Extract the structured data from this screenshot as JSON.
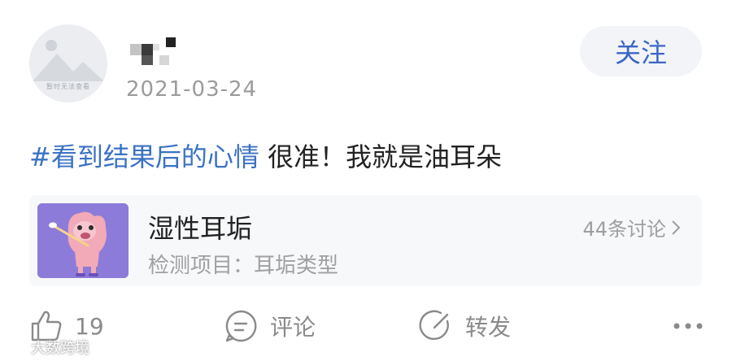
{
  "post": {
    "avatar_caption": "暂时无法查看",
    "date": "2021-03-24",
    "follow_label": "关注",
    "hashtag": "#看到结果后的心情",
    "body": " 很准！我就是油耳朵"
  },
  "card": {
    "title": "湿性耳垢",
    "subtitle": "检测项目：耳垢类型",
    "link": "44条讨论"
  },
  "actions": {
    "like_count": "19",
    "comment_label": "评论",
    "share_label": "转发"
  },
  "watermark": "大数跨境",
  "colors": {
    "accent_blue": "#3a66c6",
    "hashtag_blue": "#3a72c4",
    "card_bg": "#f7f8fa",
    "thumb_purple": "#8d7bd9"
  }
}
